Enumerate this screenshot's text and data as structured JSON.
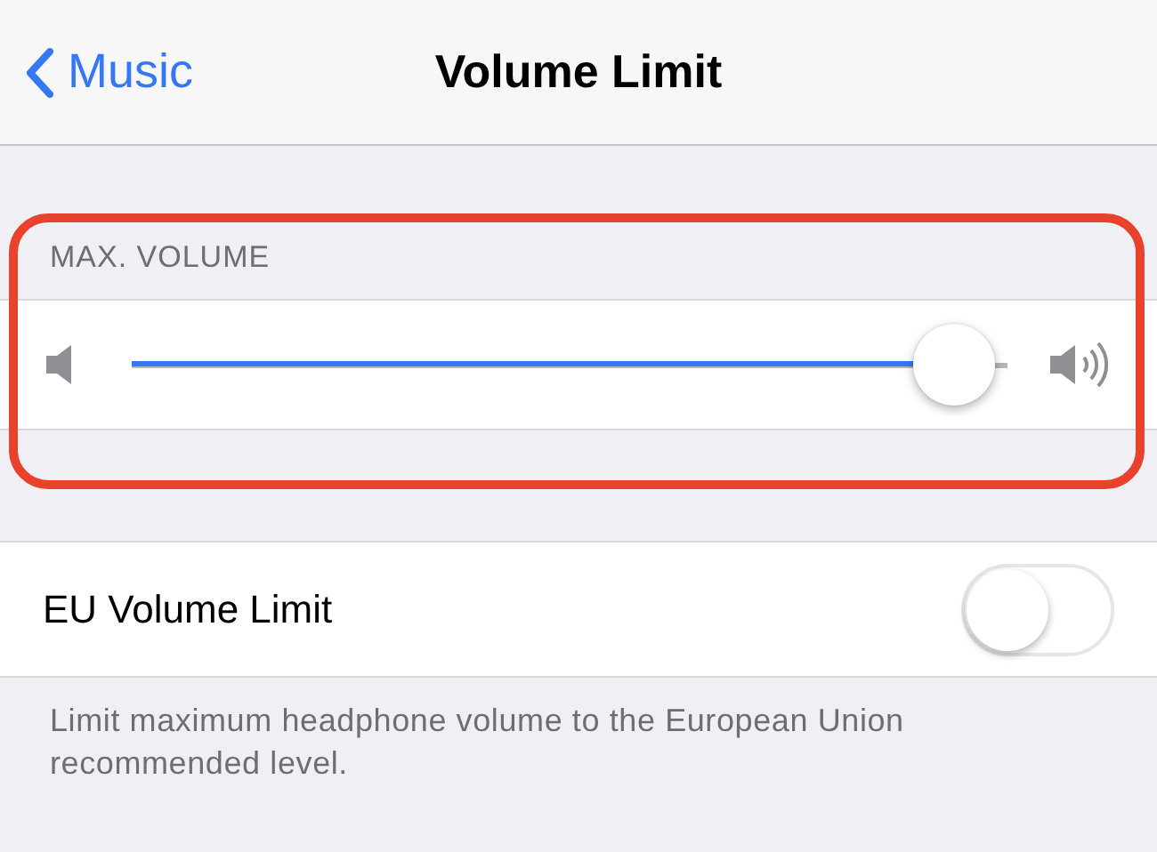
{
  "nav": {
    "back_label": "Music",
    "title": "Volume Limit"
  },
  "volume_section": {
    "header": "MAX. VOLUME",
    "slider": {
      "level": 0.94
    },
    "highlighted": true
  },
  "eu_limit": {
    "label": "EU Volume Limit",
    "on": false,
    "footer": "Limit maximum headphone volume to the European Union recommended level."
  }
}
